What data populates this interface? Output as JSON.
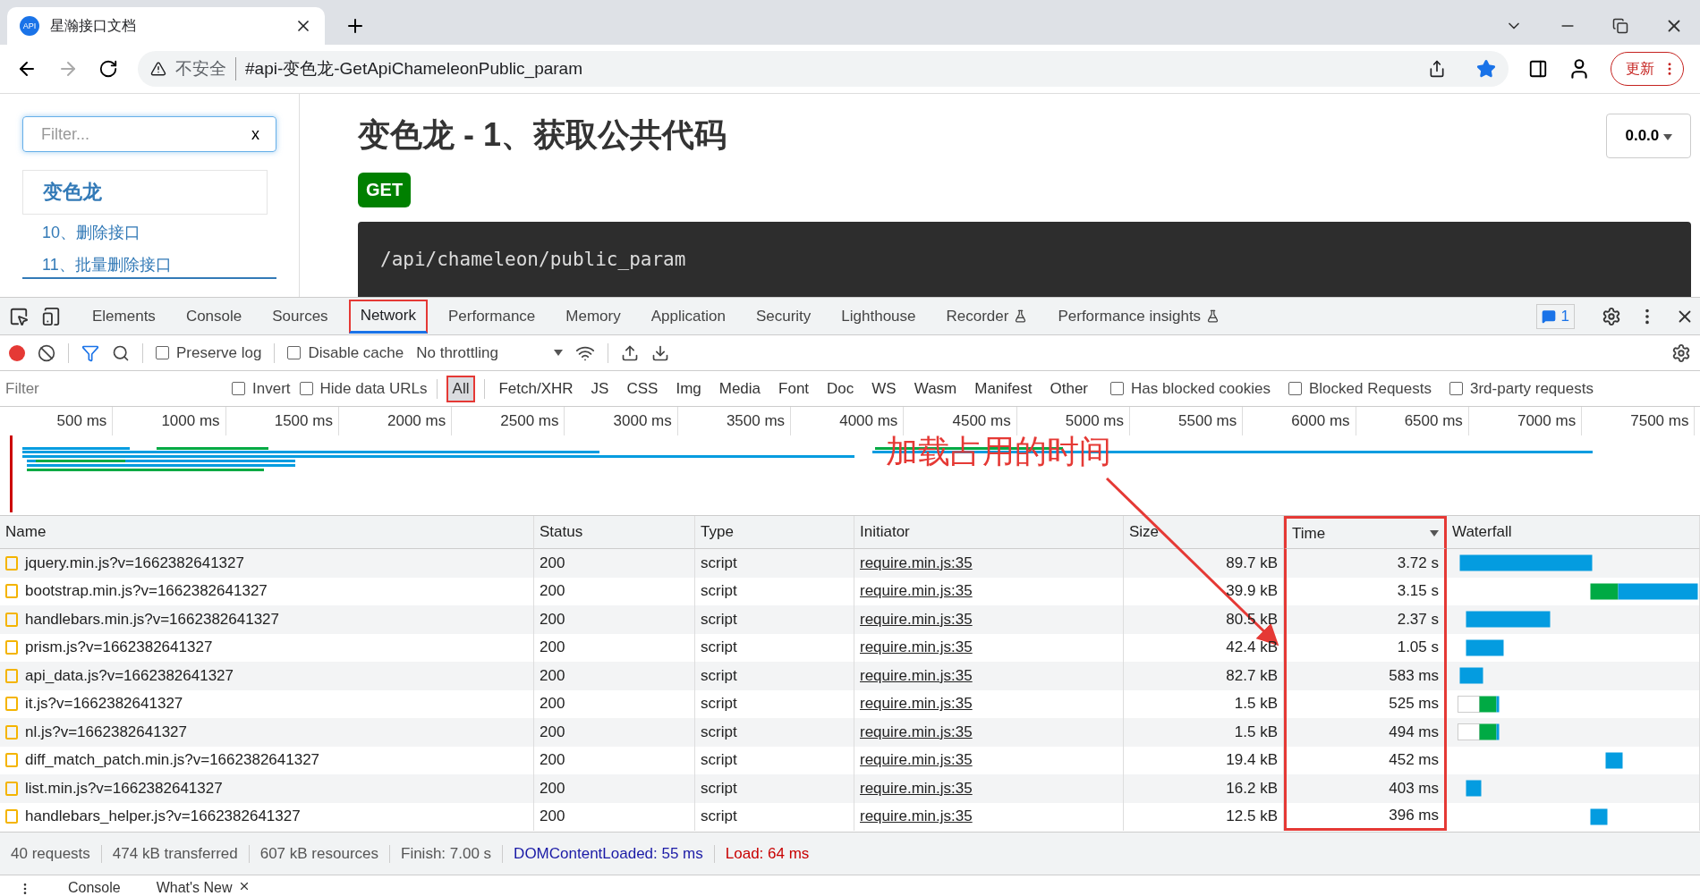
{
  "browser": {
    "tab_icon": "API",
    "tab_title": "星瀚接口文档",
    "url_warning": "不安全",
    "url": "#api-变色龙-GetApiChameleonPublic_param",
    "update_button": "更新"
  },
  "page": {
    "filter_placeholder": "Filter...",
    "filter_clear": "x",
    "group": "变色龙",
    "nav_items": [
      "10、删除接口",
      "11、批量删除接口"
    ],
    "title": "变色龙 - 1、获取公共代码",
    "method": "GET",
    "path": "/api/chameleon/public_param",
    "version": "0.0.0"
  },
  "devtools": {
    "tabs": [
      {
        "label": "Elements",
        "selected": false,
        "marked": false,
        "experimental": false
      },
      {
        "label": "Console",
        "selected": false,
        "marked": false,
        "experimental": false
      },
      {
        "label": "Sources",
        "selected": false,
        "marked": false,
        "experimental": false
      },
      {
        "label": "Network",
        "selected": true,
        "marked": true,
        "experimental": false
      },
      {
        "label": "Performance",
        "selected": false,
        "marked": false,
        "experimental": false
      },
      {
        "label": "Memory",
        "selected": false,
        "marked": false,
        "experimental": false
      },
      {
        "label": "Application",
        "selected": false,
        "marked": false,
        "experimental": false
      },
      {
        "label": "Security",
        "selected": false,
        "marked": false,
        "experimental": false
      },
      {
        "label": "Lighthouse",
        "selected": false,
        "marked": false,
        "experimental": false
      },
      {
        "label": "Recorder",
        "selected": false,
        "marked": false,
        "experimental": true
      },
      {
        "label": "Performance insights",
        "selected": false,
        "marked": false,
        "experimental": true
      }
    ],
    "issues_count": "1",
    "toolbar": {
      "preserve_log": {
        "label": "Preserve log",
        "checked": false
      },
      "disable_cache": {
        "label": "Disable cache",
        "checked": false
      },
      "throttling": "No throttling"
    },
    "filter": {
      "placeholder": "Filter",
      "options": [
        {
          "label": "Invert",
          "checked": false
        },
        {
          "label": "Hide data URLs",
          "checked": false
        }
      ],
      "types": [
        {
          "label": "All",
          "selected": true,
          "marked": true
        },
        {
          "label": "Fetch/XHR",
          "selected": false,
          "marked": false
        },
        {
          "label": "JS",
          "selected": false,
          "marked": false
        },
        {
          "label": "CSS",
          "selected": false,
          "marked": false
        },
        {
          "label": "Img",
          "selected": false,
          "marked": false
        },
        {
          "label": "Media",
          "selected": false,
          "marked": false
        },
        {
          "label": "Font",
          "selected": false,
          "marked": false
        },
        {
          "label": "Doc",
          "selected": false,
          "marked": false
        },
        {
          "label": "WS",
          "selected": false,
          "marked": false
        },
        {
          "label": "Wasm",
          "selected": false,
          "marked": false
        },
        {
          "label": "Manifest",
          "selected": false,
          "marked": false
        },
        {
          "label": "Other",
          "selected": false,
          "marked": false
        }
      ],
      "extra_options": [
        {
          "label": "Has blocked cookies",
          "checked": false
        },
        {
          "label": "Blocked Requests",
          "checked": false
        },
        {
          "label": "3rd-party requests",
          "checked": false
        }
      ]
    },
    "timeline_ticks": [
      "500 ms",
      "1000 ms",
      "1500 ms",
      "2000 ms",
      "2500 ms",
      "3000 ms",
      "3500 ms",
      "4000 ms",
      "4500 ms",
      "5000 ms",
      "5500 ms",
      "6000 ms",
      "6500 ms",
      "7000 ms",
      "7500 ms"
    ],
    "table": {
      "columns": [
        {
          "label": "Name",
          "sorted": false,
          "marked": false
        },
        {
          "label": "Status",
          "sorted": false,
          "marked": false
        },
        {
          "label": "Type",
          "sorted": false,
          "marked": false
        },
        {
          "label": "Initiator",
          "sorted": false,
          "marked": false
        },
        {
          "label": "Size",
          "sorted": false,
          "marked": false
        },
        {
          "label": "Time",
          "sorted": true,
          "marked": true
        },
        {
          "label": "Waterfall",
          "sorted": false,
          "marked": false
        }
      ],
      "rows": [
        {
          "name": "jquery.min.js?v=1662382641327",
          "status": "200",
          "type": "script",
          "initiator": "require.min.js:35",
          "size": "89.7 kB",
          "time": "3.72 s"
        },
        {
          "name": "bootstrap.min.js?v=1662382641327",
          "status": "200",
          "type": "script",
          "initiator": "require.min.js:35",
          "size": "39.9 kB",
          "time": "3.15 s"
        },
        {
          "name": "handlebars.min.js?v=1662382641327",
          "status": "200",
          "type": "script",
          "initiator": "require.min.js:35",
          "size": "80.5 kB",
          "time": "2.37 s"
        },
        {
          "name": "prism.js?v=1662382641327",
          "status": "200",
          "type": "script",
          "initiator": "require.min.js:35",
          "size": "42.4 kB",
          "time": "1.05 s"
        },
        {
          "name": "api_data.js?v=1662382641327",
          "status": "200",
          "type": "script",
          "initiator": "require.min.js:35",
          "size": "82.7 kB",
          "time": "583 ms"
        },
        {
          "name": "it.js?v=1662382641327",
          "status": "200",
          "type": "script",
          "initiator": "require.min.js:35",
          "size": "1.5 kB",
          "time": "525 ms"
        },
        {
          "name": "nl.js?v=1662382641327",
          "status": "200",
          "type": "script",
          "initiator": "require.min.js:35",
          "size": "1.5 kB",
          "time": "494 ms"
        },
        {
          "name": "diff_match_patch.min.js?v=1662382641327",
          "status": "200",
          "type": "script",
          "initiator": "require.min.js:35",
          "size": "19.4 kB",
          "time": "452 ms"
        },
        {
          "name": "list.min.js?v=1662382641327",
          "status": "200",
          "type": "script",
          "initiator": "require.min.js:35",
          "size": "16.2 kB",
          "time": "403 ms"
        },
        {
          "name": "handlebars_helper.js?v=1662382641327",
          "status": "200",
          "type": "script",
          "initiator": "require.min.js:35",
          "size": "12.5 kB",
          "time": "396 ms"
        }
      ]
    },
    "status_bar": [
      {
        "text": "40 requests",
        "kind": "plain"
      },
      {
        "text": "474 kB transferred",
        "kind": "plain"
      },
      {
        "text": "607 kB resources",
        "kind": "plain"
      },
      {
        "text": "Finish: 7.00 s",
        "kind": "plain"
      },
      {
        "text": "DOMContentLoaded: 55 ms",
        "kind": "dom"
      },
      {
        "text": "Load: 64 ms",
        "kind": "load"
      }
    ],
    "drawer_tabs": [
      {
        "label": "Console",
        "closable": false
      },
      {
        "label": "What's New",
        "closable": true
      }
    ]
  },
  "annotation": {
    "text": "加载占用的时间"
  }
}
